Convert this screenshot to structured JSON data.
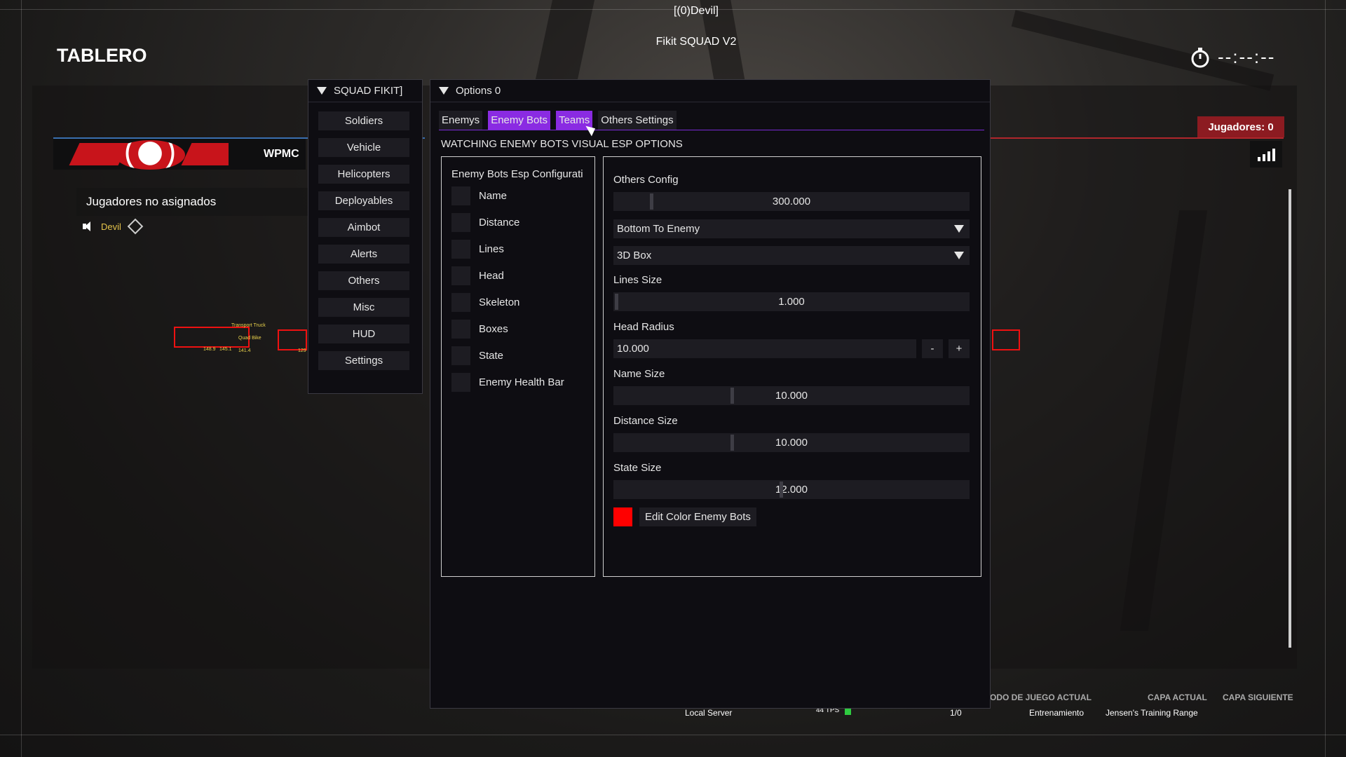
{
  "window": {
    "title": "[(0)Devil]",
    "subtitle": "Fikit SQUAD V2"
  },
  "hud": {
    "title": "TABLERO",
    "timer": "--:--:--",
    "team_name": "WPMC",
    "unassigned_label": "Jugadores no asignados",
    "player_name": "Devil",
    "jugadores": "Jugadores: 0",
    "footer": {
      "mode_label": "ODO DE JUEGO ACTUAL",
      "layer_label": "CAPA ACTUAL",
      "next_layer_label": "CAPA SIGUIENTE",
      "server": "Local Server",
      "tps": "44 TPS",
      "slots": "1/0",
      "mode_value": "Entrenamiento",
      "layer_value": "Jensen's Training Range"
    },
    "esp_labels": [
      "148.9",
      "145.1",
      "141.4",
      "Transport Truck",
      "Quad Bike",
      "129"
    ]
  },
  "left_menu": {
    "title": "SQUAD FIKIT]",
    "items": [
      "Soldiers",
      "Vehicle",
      "Helicopters",
      "Deployables",
      "Aimbot",
      "Alerts",
      "Others",
      "Misc",
      "HUD",
      "Settings"
    ]
  },
  "options": {
    "title": "Options 0",
    "tabs": [
      "Enemys",
      "Enemy Bots",
      "Teams",
      "Others Settings"
    ],
    "active_tab": "Enemy Bots",
    "section_title": "WATCHING ENEMY BOTS VISUAL ESP OPTIONS",
    "esp_config": {
      "title": "Enemy Bots Esp Configurati",
      "checkboxes": [
        "Name",
        "Distance",
        "Lines",
        "Head",
        "Skeleton",
        "Boxes",
        "State",
        "Enemy Health Bar"
      ]
    },
    "others_config": {
      "title": "Others Config",
      "distance_value": "300.000",
      "distance_level": 0.1,
      "line_position": "Bottom To Enemy",
      "box_type": "3D Box",
      "lines_size_label": "Lines Size",
      "lines_size_value": "1.000",
      "lines_size_level": 0.0,
      "head_radius_label": "Head Radius",
      "head_radius_value": "10.000",
      "minus": "-",
      "plus": "+",
      "name_size_label": "Name Size",
      "name_size_value": "10.000",
      "name_size_level": 0.33,
      "distance_size_label": "Distance Size",
      "distance_size_value": "10.000",
      "distance_size_level": 0.33,
      "state_size_label": "State Size",
      "state_size_value": "12.000",
      "state_size_level": 0.47,
      "color_label": "Edit Color Enemy Bots",
      "color": "#ff0000"
    }
  },
  "colors": {
    "accent": "#8a2be2",
    "panel_bg": "#0e0d12",
    "widget_bg": "#1d1c22",
    "team_red": "#8c1b21"
  }
}
